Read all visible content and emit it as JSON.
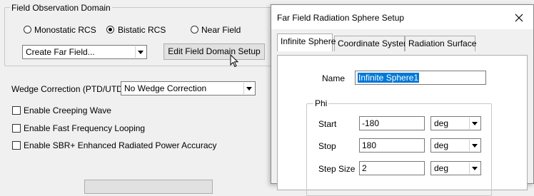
{
  "domain_group": {
    "title": "Field Observation Domain",
    "radio_monostatic": "Monostatic RCS",
    "radio_bistatic": "Bistatic RCS",
    "radio_nearfield": "Near Field",
    "far_field_combo": "Create Far Field...",
    "edit_button": "Edit Field Domain Setup"
  },
  "wedge": {
    "label": "Wedge Correction (PTD/UTD):",
    "value": "No Wedge Correction"
  },
  "checkboxes": {
    "creeping": "Enable Creeping Wave",
    "fast_freq": "Enable Fast Frequency Looping",
    "sbr_power": "Enable SBR+ Enhanced Radiated Power Accuracy"
  },
  "dialog": {
    "title": "Far Field Radiation Sphere Setup",
    "tabs": [
      "Infinite Sphere",
      "Coordinate System",
      "Radiation Surface"
    ],
    "name_label": "Name",
    "name_value": "Infinite Sphere1",
    "phi_group": "Phi",
    "start_label": "Start",
    "start_value": "-180",
    "start_unit": "deg",
    "stop_label": "Stop",
    "stop_value": "180",
    "stop_unit": "deg",
    "step_label": "Step Size",
    "step_value": "2",
    "step_unit": "deg"
  },
  "icons": {
    "close": "close-icon",
    "cursor": "mouse-cursor-icon",
    "dropdown": "chevron-down-icon"
  }
}
